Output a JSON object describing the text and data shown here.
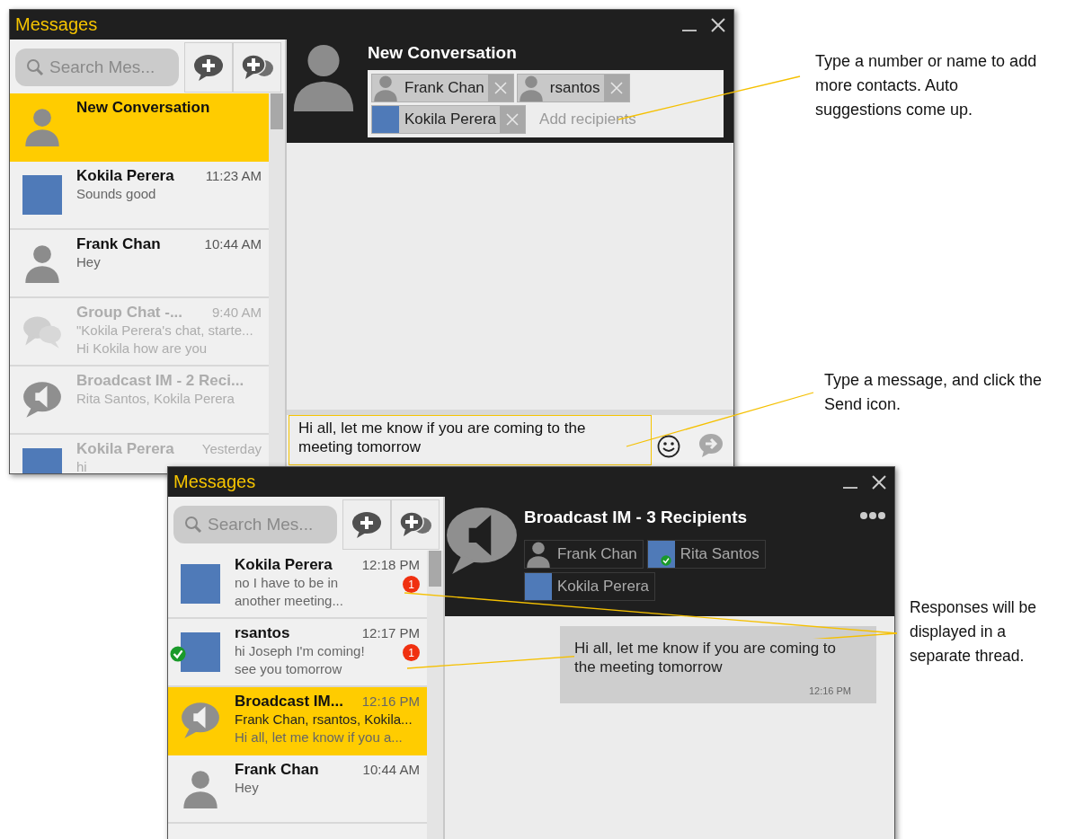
{
  "compose_window": {
    "title": "Messages",
    "search": {
      "placeholder": "Search Mes..."
    },
    "conversations": [
      {
        "name": "New Conversation",
        "kind": "person",
        "selected": true,
        "dimmed": false,
        "online": false
      },
      {
        "name": "Kokila Perera",
        "time": "11:23 AM",
        "lines": [
          "Sounds good"
        ],
        "kind": "photo",
        "selected": false,
        "dimmed": false,
        "online": false
      },
      {
        "name": "Frank Chan",
        "time": "10:44 AM",
        "lines": [
          "Hey"
        ],
        "kind": "person",
        "selected": false,
        "dimmed": false,
        "online": false
      },
      {
        "name": "Group Chat -...",
        "time": "9:40 AM",
        "lines": [
          "\"Kokila Perera's chat, starte...",
          "Hi Kokila how are you"
        ],
        "kind": "group",
        "selected": false,
        "dimmed": true,
        "online": false
      },
      {
        "name": "Broadcast IM - 2 Reci...",
        "lines": [
          "Rita Santos, Kokila Perera"
        ],
        "kind": "broadcast",
        "selected": false,
        "dimmed": true,
        "online": false
      },
      {
        "name": "Kokila Perera",
        "time": "Yesterday",
        "lines": [
          "hi"
        ],
        "kind": "photo",
        "selected": false,
        "dimmed": true,
        "online": false
      }
    ],
    "header": {
      "title": "New Conversation",
      "kind": "person",
      "recipients": [
        {
          "name": "Frank Chan",
          "kind": "person"
        },
        {
          "name": "rsantos",
          "kind": "person"
        },
        {
          "name": "Kokila Perera",
          "kind": "photo"
        }
      ],
      "placeholder": "Add recipients"
    },
    "composer": {
      "value": "Hi all, let me know if you are coming to the meeting tomorrow"
    }
  },
  "broadcast_window": {
    "title": "Messages",
    "search": {
      "placeholder": "Search Mes..."
    },
    "conversations": [
      {
        "name": "Kokila Perera",
        "time": "12:18 PM",
        "lines": [
          "no I have to be in",
          "another meeting..."
        ],
        "badge": "1",
        "kind": "photo",
        "selected": false,
        "dimmed": false,
        "online": false
      },
      {
        "name": "rsantos",
        "time": "12:17 PM",
        "lines": [
          "hi Joseph I'm coming!",
          "see you tomorrow"
        ],
        "badge": "1",
        "kind": "photo",
        "selected": false,
        "dimmed": false,
        "online": true
      },
      {
        "name": "Broadcast IM...",
        "time": "12:16 PM",
        "lines": [
          "Frank Chan, rsantos, Kokila...",
          "Hi all, let me know if you a..."
        ],
        "kind": "broadcast",
        "selected": true,
        "dimmed": false,
        "online": false
      },
      {
        "name": "Frank Chan",
        "time": "10:44 AM",
        "lines": [
          "Hey"
        ],
        "kind": "person",
        "selected": false,
        "dimmed": false,
        "online": false
      }
    ],
    "header": {
      "title": "Broadcast IM - 3 Recipients",
      "kind": "broadcast",
      "recipients": [
        {
          "name": "Frank Chan",
          "kind": "person",
          "online": false
        },
        {
          "name": "Rita Santos",
          "kind": "photo",
          "online": true
        },
        {
          "name": "Kokila Perera",
          "kind": "photo",
          "online": false
        }
      ]
    },
    "messages": [
      {
        "text": "Hi all, let me know if you are coming to the meeting tomorrow",
        "time": "12:16 PM"
      }
    ]
  },
  "callouts": [
    {
      "text": "Type a number or name to add more contacts. Auto suggestions come up."
    },
    {
      "text": "Type a message, and click the Send icon."
    },
    {
      "text": "Responses will be displayed in a separate thread."
    }
  ]
}
